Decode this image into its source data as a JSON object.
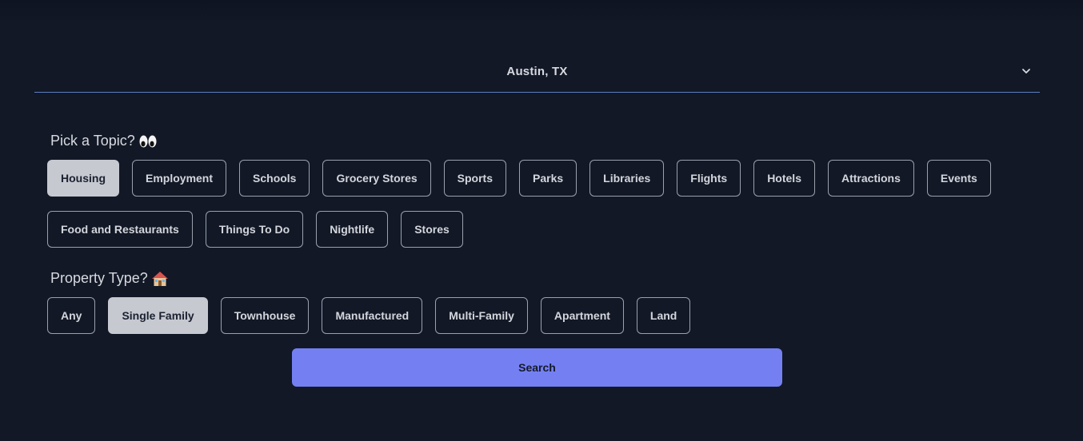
{
  "location": {
    "value": "Austin, TX",
    "icon": "chevron-down-icon"
  },
  "topic_section": {
    "label": "Pick a Topic?",
    "emoji_icon": "eyes-icon"
  },
  "topics": [
    {
      "label": "Housing",
      "selected": true
    },
    {
      "label": "Employment",
      "selected": false
    },
    {
      "label": "Schools",
      "selected": false
    },
    {
      "label": "Grocery Stores",
      "selected": false
    },
    {
      "label": "Sports",
      "selected": false
    },
    {
      "label": "Parks",
      "selected": false
    },
    {
      "label": "Libraries",
      "selected": false
    },
    {
      "label": "Flights",
      "selected": false
    },
    {
      "label": "Hotels",
      "selected": false
    },
    {
      "label": "Attractions",
      "selected": false
    },
    {
      "label": "Events",
      "selected": false
    },
    {
      "label": "Food and Restaurants",
      "selected": false
    },
    {
      "label": "Things To Do",
      "selected": false
    },
    {
      "label": "Nightlife",
      "selected": false
    },
    {
      "label": "Stores",
      "selected": false
    }
  ],
  "property_section": {
    "label": "Property Type?",
    "emoji_icon": "house-icon"
  },
  "property_types": [
    {
      "label": "Any",
      "selected": false
    },
    {
      "label": "Single Family",
      "selected": true
    },
    {
      "label": "Townhouse",
      "selected": false
    },
    {
      "label": "Manufactured",
      "selected": false
    },
    {
      "label": "Multi-Family",
      "selected": false
    },
    {
      "label": "Apartment",
      "selected": false
    },
    {
      "label": "Land",
      "selected": false
    }
  ],
  "search": {
    "label": "Search"
  },
  "colors": {
    "background": "#121826",
    "accent": "#7480f2",
    "selected_chip": "#c6c9d0",
    "underline": "#5b7fc4"
  }
}
